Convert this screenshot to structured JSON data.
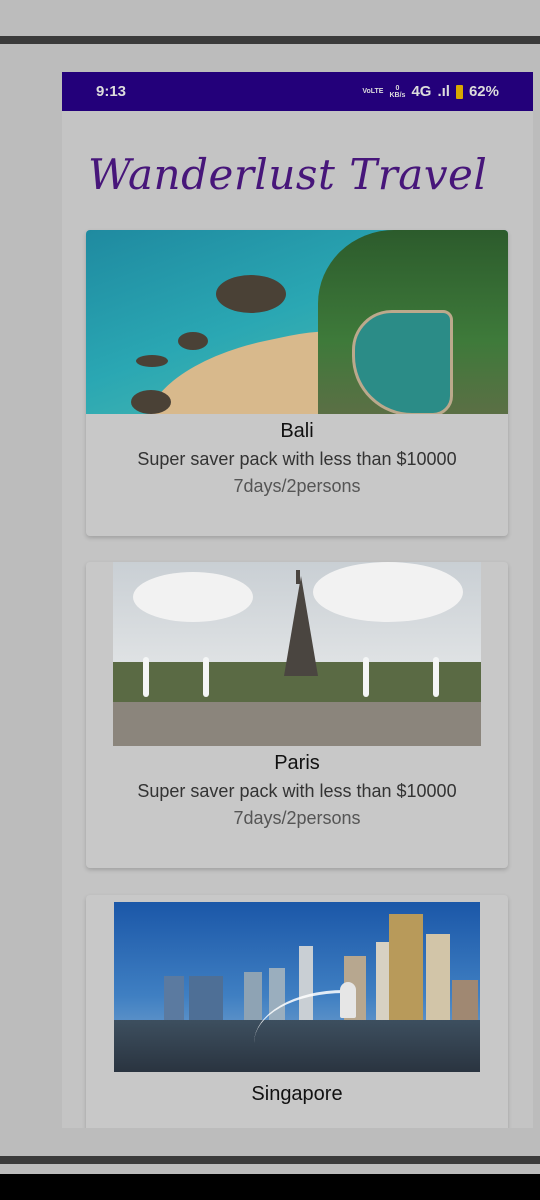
{
  "status_bar": {
    "time": "9:13",
    "network_top": "VoLTE",
    "data_rate_value": "0",
    "data_rate_unit": "KB/s",
    "network_type": "4G",
    "battery": "62%"
  },
  "app": {
    "title": "Wanderlust Travel"
  },
  "packages": [
    {
      "name": "Bali",
      "description": "Super saver pack with less than $10000",
      "duration": "7days/2persons",
      "image": "bali-beach-pool"
    },
    {
      "name": "Paris",
      "description": "Super saver pack with less than $10000",
      "duration": "7days/2persons",
      "image": "eiffel-tower"
    },
    {
      "name": "Singapore",
      "image": "singapore-skyline-merlion"
    }
  ],
  "colors": {
    "status_bar": "#23007a",
    "title": "#47167a",
    "overlay_background": "#bcbcbc"
  }
}
